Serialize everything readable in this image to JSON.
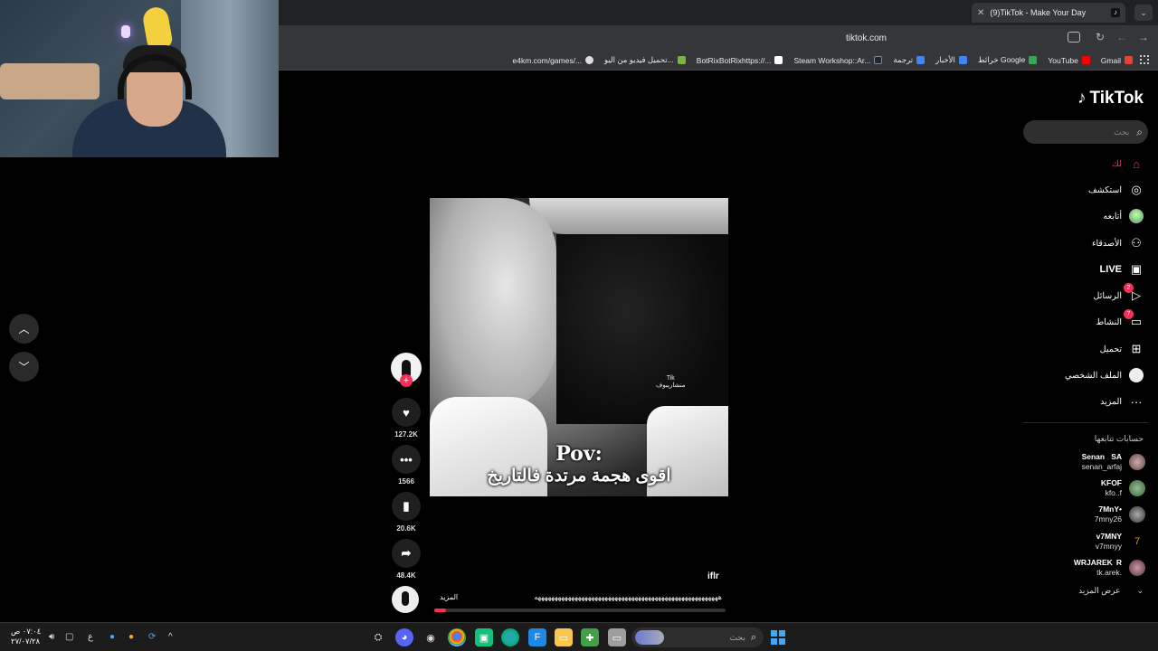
{
  "browser": {
    "tab_title": "(9)TikTok - Make Your Day",
    "new_tab": "+",
    "url": "tiktok.com",
    "bookmarks": [
      {
        "label": "Gmail",
        "color": "#ea4335"
      },
      {
        "label": "YouTube",
        "color": "#ff0000"
      },
      {
        "label": "خرائط Google",
        "color": "#34a853"
      },
      {
        "label": "الأخبار",
        "color": "#4285f4"
      },
      {
        "label": "ترجمة",
        "color": "#4285f4"
      },
      {
        "label": "Steam Workshop::Ar...",
        "color": "#1b2838"
      },
      {
        "label": "BotRixBotRixhttps://...",
        "color": "#ffffff"
      },
      {
        "label": "تحميل فيديو من اليو...",
        "color": "#7cb342"
      },
      {
        "label": "e4km.com/games/...",
        "color": "#dddddd"
      }
    ]
  },
  "tiktok": {
    "brand": "TikTok",
    "search_placeholder": "بحث",
    "nav": [
      {
        "label": "لك",
        "icon": "home-icon",
        "active": true
      },
      {
        "label": "استكشف",
        "icon": "compass-icon"
      },
      {
        "label": "أتابعه",
        "icon": "avatar-icon"
      },
      {
        "label": "الأصدقاء",
        "icon": "friends-icon"
      },
      {
        "label": "LIVE",
        "icon": "live-icon"
      },
      {
        "label": "الرسائل",
        "icon": "messages-icon",
        "badge": "2"
      },
      {
        "label": "النشاط",
        "icon": "activity-icon",
        "badge": "7"
      },
      {
        "label": "تحميل",
        "icon": "upload-icon"
      },
      {
        "label": "الملف الشخصي",
        "icon": "profile-icon"
      },
      {
        "label": "المزيد",
        "icon": "more-icon"
      }
    ],
    "following_title": "حسابات تتابعها",
    "following": [
      {
        "name": "Senan  SA",
        "handle": "senan_arfaj"
      },
      {
        "name": "KFOF",
        "handle": "kfo..f"
      },
      {
        "name": "7MnY•",
        "handle": "7mny26"
      },
      {
        "name": "v7MNY",
        "handle": "v7mnyy"
      },
      {
        "name": "WRJAREK  R",
        "handle": "tk.arek."
      }
    ],
    "see_more": "عرض المزيد"
  },
  "video": {
    "watermark": "Tik",
    "watermark_sub": "منشاريبوف",
    "caption_line1": "Pov:",
    "caption_line2": "اقوى هجمة مرتدة فالتاريخ",
    "username": "iflr",
    "description": "هههههههههههههههههههههههههههههههههههههههههههههههههههههههه",
    "more": "المزيد",
    "progress": 0.04,
    "likes": "127.2K",
    "comments": "1566",
    "saves": "20.6K",
    "shares": "48.4K"
  },
  "taskbar": {
    "search_placeholder": "بحث",
    "time": "٠٧:٠٤ ص",
    "date": "٢٧/٠٧/٢٨",
    "lang": "ع"
  },
  "colors": {
    "accent": "#fe2c55",
    "bg": "#000000"
  }
}
